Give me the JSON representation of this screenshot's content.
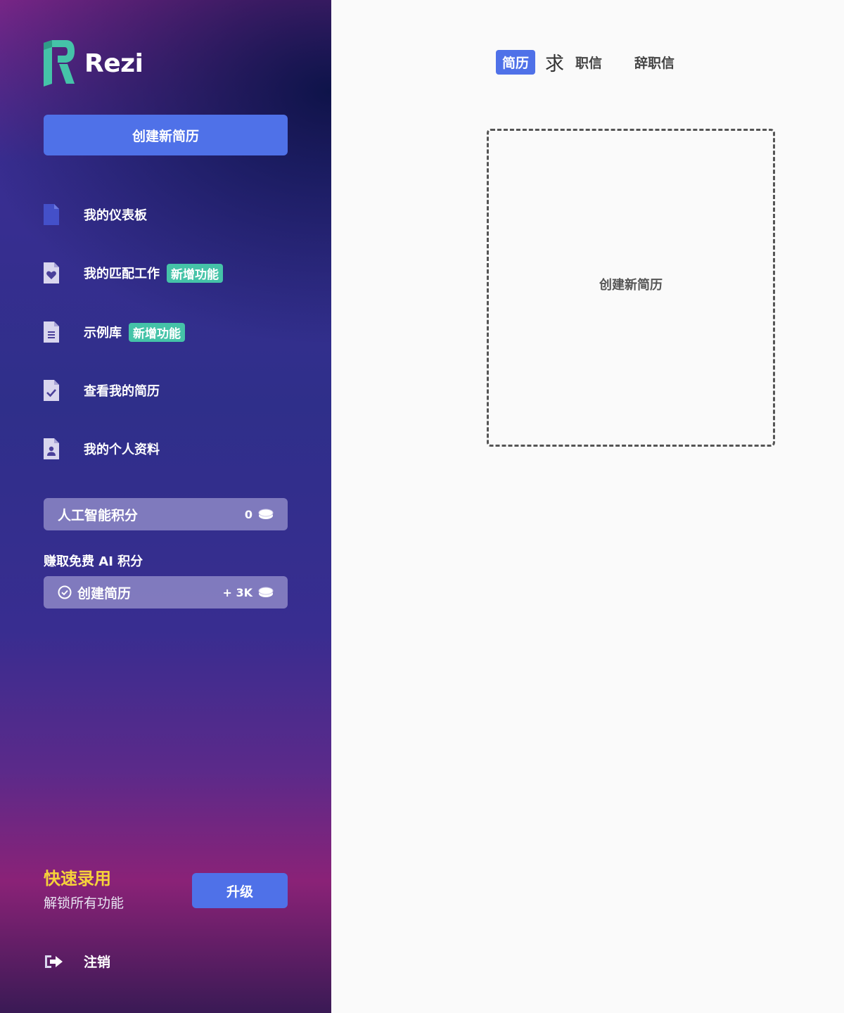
{
  "sidebar": {
    "brand": "Rezi",
    "create_button": "创建新简历",
    "nav": [
      {
        "label": "我的仪表板",
        "icon": "document-icon",
        "badge": ""
      },
      {
        "label": "我的匹配工作",
        "icon": "heart-document-icon",
        "badge": "新增功能"
      },
      {
        "label": "示例库",
        "icon": "list-document-icon",
        "badge": "新增功能"
      },
      {
        "label": "查看我的简历",
        "icon": "check-document-icon",
        "badge": ""
      },
      {
        "label": "我的个人资料",
        "icon": "profile-document-icon",
        "badge": ""
      }
    ],
    "ai_credits": {
      "label": "人工智能积分",
      "value": "0"
    },
    "earn": {
      "title": "赚取免费 AI 积分",
      "task": {
        "label": "创建简历",
        "reward": "+ 3K"
      }
    },
    "promo": {
      "title": "快速录用",
      "subtitle": "解锁所有功能",
      "button": "升级"
    },
    "logout": "注销"
  },
  "main": {
    "tabs": [
      {
        "label": "简历"
      },
      {
        "label": "求"
      },
      {
        "label": "职信"
      },
      {
        "label": "辞职信"
      }
    ],
    "new_card_label": "创建新简历"
  },
  "colors": {
    "accent": "#4f71e8",
    "badge": "#45c3a8",
    "promo": "#f6d33a",
    "logo": "#45c3a8"
  }
}
